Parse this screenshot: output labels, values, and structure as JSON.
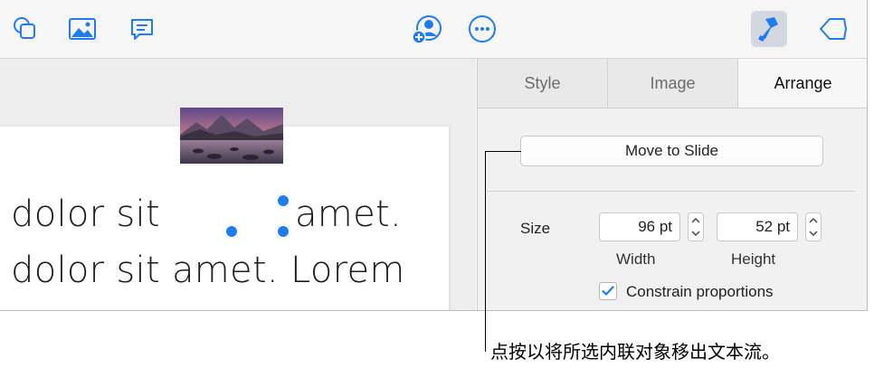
{
  "toolbar": {
    "icons": [
      "shapes-icon",
      "media-icon",
      "comment-icon",
      "collaborate-icon",
      "more-icon",
      "format-icon",
      "document-icon"
    ],
    "active_item": "format-icon"
  },
  "slide": {
    "line1_before": "dolor sit",
    "line1_after": "amet.",
    "line2": "dolor sit amet. Lorem"
  },
  "inspector": {
    "tabs": [
      {
        "label": "Style",
        "active": false
      },
      {
        "label": "Image",
        "active": false
      },
      {
        "label": "Arrange",
        "active": true
      }
    ],
    "move_button_label": "Move to Slide",
    "size_label": "Size",
    "width_value": "96 pt",
    "height_value": "52 pt",
    "width_caption": "Width",
    "height_caption": "Height",
    "constrain_label": "Constrain proportions",
    "constrain_checked": true
  },
  "callout": {
    "text": "点按以将所选内联对象移出文本流。"
  },
  "colors": {
    "accent": "#1f7cf0",
    "active_toolbar_bg": "#d3d8e0"
  }
}
